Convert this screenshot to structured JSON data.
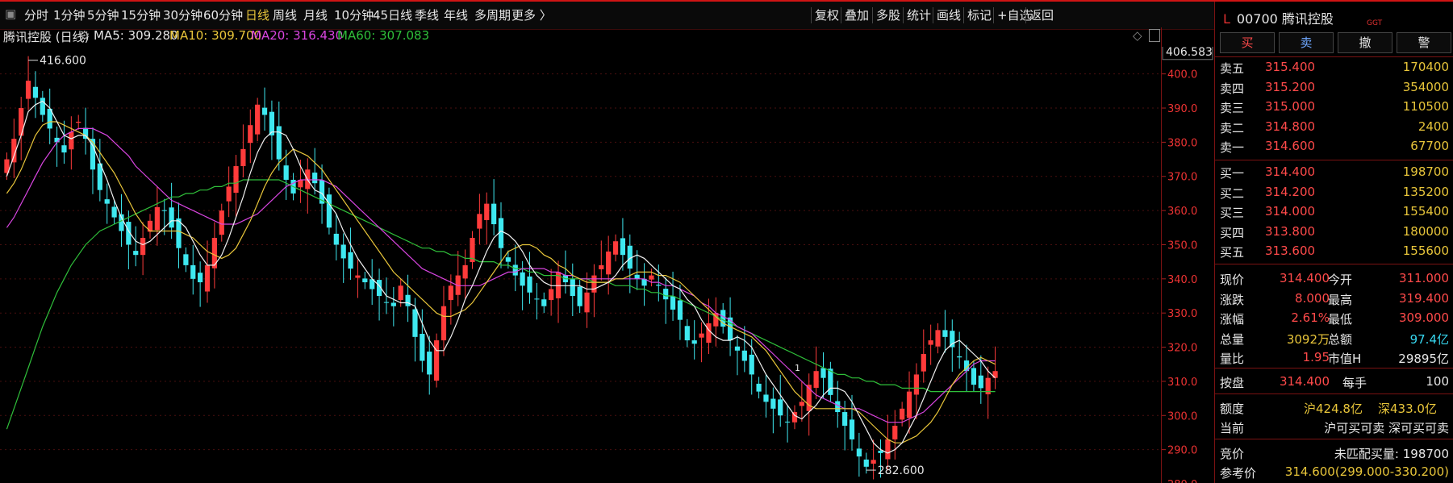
{
  "toolbar": {
    "periods": [
      "分时",
      "1分钟",
      "5分钟",
      "15分钟",
      "30分钟",
      "60分钟",
      "日线",
      "周线",
      "月线",
      "10分钟",
      "45日线",
      "季线",
      "年线",
      "多周期",
      "更多 〉"
    ],
    "active_period": "日线",
    "tools": [
      "复权",
      "叠加",
      "多股",
      "统计",
      "画线",
      "标记",
      "+自选",
      "返回"
    ]
  },
  "indicators": {
    "stock": "腾讯控股 (日线)",
    "ma5": "MA5: 309.280",
    "ma10": "MA10: 309.700",
    "ma20": "MA20: 316.430",
    "ma60": "MA60: 307.083"
  },
  "chart_data": {
    "type": "candlestick",
    "ylim": [
      280,
      407
    ],
    "y_ticks": [
      "400.0",
      "390.0",
      "380.0",
      "370.0",
      "360.0",
      "350.0",
      "340.0",
      "330.0",
      "320.0",
      "310.0",
      "300.0",
      "290.0",
      "280.0"
    ],
    "current_price_label": "406.583",
    "high_label": "416.600",
    "low_label": "282.600",
    "annotation": "1",
    "closes": [
      375,
      381,
      390,
      398,
      393,
      388,
      384,
      380,
      377,
      383,
      386,
      381,
      372,
      366,
      362,
      358,
      354,
      350,
      347,
      352,
      357,
      361,
      360,
      355,
      349,
      344,
      340,
      339,
      344,
      352,
      360,
      367,
      373,
      378,
      385,
      391,
      388,
      382,
      375,
      369,
      365,
      369,
      372,
      368,
      362,
      355,
      350,
      346,
      343,
      341,
      339,
      337,
      335,
      333,
      332,
      338,
      332,
      323,
      316,
      312,
      322,
      332,
      338,
      341,
      344,
      352,
      359,
      362,
      356,
      349,
      345,
      341,
      338,
      336,
      334,
      332,
      337,
      342,
      339,
      335,
      332,
      336,
      341,
      344,
      348,
      351,
      347,
      343,
      340,
      338,
      341,
      338,
      334,
      331,
      328,
      322,
      321,
      324,
      327,
      330,
      326,
      322,
      319,
      316,
      312,
      307,
      304,
      302,
      300,
      298,
      301,
      304,
      309,
      313,
      311,
      306,
      301,
      297,
      293,
      288,
      285,
      287,
      289,
      293,
      297,
      302,
      307,
      312,
      318,
      322,
      325,
      323,
      320,
      317,
      313,
      309,
      308,
      311,
      313
    ],
    "ma5": [
      370,
      376,
      382,
      389,
      391,
      392,
      390,
      386,
      382,
      381,
      382,
      382,
      379,
      374,
      369,
      363,
      358,
      354,
      351,
      350,
      351,
      353,
      355,
      357,
      357,
      355,
      351,
      347,
      344,
      344,
      347,
      352,
      358,
      364,
      371,
      377,
      381,
      383,
      383,
      382,
      378,
      373,
      369,
      366,
      365,
      362,
      359,
      354,
      350,
      346,
      343,
      340,
      338,
      335,
      334,
      333,
      333,
      332,
      327,
      322,
      319,
      319,
      323,
      328,
      334,
      338,
      343,
      348,
      352,
      354,
      353,
      351,
      348,
      344,
      341,
      339,
      338,
      338,
      338,
      338,
      338,
      337,
      337,
      338,
      339,
      341,
      344,
      346,
      347,
      346,
      344,
      342,
      340,
      338,
      337,
      334,
      332,
      328,
      325,
      323,
      322,
      322,
      323,
      322,
      320,
      316,
      312,
      309,
      306,
      303,
      300,
      299,
      301,
      303,
      306,
      308,
      308,
      307,
      304,
      300,
      296,
      292,
      290,
      289,
      290,
      292,
      296,
      300,
      305,
      310,
      315,
      319,
      321,
      322,
      320,
      318,
      316,
      313,
      311
    ],
    "ma10": [
      365,
      368,
      372,
      377,
      382,
      385,
      386,
      386,
      385,
      384,
      383,
      382,
      380,
      377,
      374,
      371,
      367,
      363,
      359,
      356,
      354,
      354,
      354,
      354,
      354,
      353,
      352,
      350,
      348,
      347,
      346,
      347,
      349,
      353,
      357,
      362,
      367,
      371,
      374,
      376,
      378,
      377,
      376,
      374,
      372,
      369,
      366,
      363,
      360,
      357,
      354,
      351,
      348,
      345,
      342,
      340,
      338,
      336,
      334,
      332,
      330,
      329,
      329,
      330,
      331,
      333,
      336,
      339,
      342,
      345,
      348,
      349,
      350,
      350,
      349,
      347,
      346,
      344,
      343,
      341,
      340,
      339,
      339,
      339,
      339,
      340,
      340,
      341,
      342,
      342,
      342,
      341,
      341,
      340,
      339,
      337,
      335,
      333,
      331,
      329,
      327,
      326,
      325,
      324,
      323,
      321,
      319,
      316,
      313,
      310,
      307,
      305,
      303,
      302,
      302,
      302,
      302,
      302,
      302,
      301,
      299,
      297,
      295,
      293,
      292,
      292,
      293,
      294,
      296,
      298,
      301,
      305,
      309,
      312,
      314,
      316,
      317,
      316,
      315
    ],
    "ma20": [
      355,
      358,
      362,
      366,
      370,
      374,
      377,
      380,
      382,
      383,
      384,
      384,
      384,
      383,
      382,
      380,
      378,
      376,
      373,
      371,
      369,
      367,
      365,
      363,
      362,
      361,
      360,
      359,
      358,
      357,
      356,
      356,
      356,
      357,
      358,
      359,
      361,
      363,
      365,
      367,
      368,
      369,
      369,
      369,
      369,
      368,
      367,
      365,
      363,
      361,
      359,
      357,
      355,
      353,
      351,
      349,
      347,
      345,
      343,
      342,
      341,
      340,
      339,
      338,
      338,
      338,
      338,
      339,
      340,
      341,
      342,
      342,
      343,
      343,
      343,
      343,
      342,
      342,
      341,
      341,
      340,
      340,
      340,
      340,
      340,
      340,
      340,
      340,
      340,
      340,
      339,
      339,
      338,
      338,
      337,
      336,
      335,
      333,
      332,
      330,
      329,
      328,
      326,
      325,
      324,
      322,
      320,
      318,
      316,
      314,
      312,
      310,
      308,
      306,
      305,
      304,
      303,
      302,
      302,
      302,
      301,
      300,
      299,
      298,
      298,
      298,
      299,
      300,
      301,
      303,
      305,
      307,
      309,
      311,
      313,
      315,
      316,
      316,
      316
    ],
    "ma60": [
      296,
      302,
      308,
      314,
      320,
      326,
      331,
      336,
      340,
      344,
      347,
      350,
      352,
      354,
      355,
      356,
      357,
      358,
      359,
      360,
      361,
      362,
      363,
      364,
      364,
      365,
      365,
      366,
      366,
      367,
      367,
      368,
      368,
      369,
      369,
      369,
      369,
      369,
      369,
      368,
      367,
      366,
      365,
      364,
      363,
      362,
      361,
      360,
      359,
      358,
      357,
      356,
      355,
      354,
      353,
      352,
      351,
      350,
      349,
      349,
      348,
      348,
      347,
      347,
      346,
      346,
      345,
      345,
      345,
      344,
      344,
      343,
      343,
      342,
      342,
      341,
      341,
      341,
      340,
      340,
      340,
      340,
      339,
      339,
      339,
      338,
      338,
      338,
      337,
      337,
      336,
      336,
      335,
      335,
      334,
      333,
      332,
      331,
      330,
      329,
      328,
      327,
      326,
      325,
      324,
      323,
      322,
      321,
      320,
      319,
      318,
      317,
      316,
      315,
      314,
      313,
      312,
      312,
      311,
      311,
      310,
      310,
      309,
      309,
      309,
      308,
      308,
      308,
      308,
      307,
      307,
      307,
      307,
      307,
      307,
      307,
      307,
      307,
      307
    ]
  },
  "side": {
    "header_marker": "L",
    "code_name": "00700 腾讯控股",
    "tag": "GGT",
    "buttons": [
      "买",
      "卖",
      "撤",
      "警"
    ],
    "asks": [
      {
        "label": "卖五",
        "price": "315.400",
        "vol": "170400"
      },
      {
        "label": "卖四",
        "price": "315.200",
        "vol": "354000"
      },
      {
        "label": "卖三",
        "price": "315.000",
        "vol": "110500"
      },
      {
        "label": "卖二",
        "price": "314.800",
        "vol": "2400"
      },
      {
        "label": "卖一",
        "price": "314.600",
        "vol": "67700"
      }
    ],
    "bids": [
      {
        "label": "买一",
        "price": "314.400",
        "vol": "198700"
      },
      {
        "label": "买二",
        "price": "314.200",
        "vol": "135200"
      },
      {
        "label": "买三",
        "price": "314.000",
        "vol": "155400"
      },
      {
        "label": "买四",
        "price": "313.800",
        "vol": "180000"
      },
      {
        "label": "买五",
        "price": "313.600",
        "vol": "155600"
      }
    ],
    "stats": [
      {
        "l1": "现价",
        "v1": "314.400",
        "l2": "今开",
        "v2": "311.000"
      },
      {
        "l1": "涨跌",
        "v1": "8.000",
        "l2": "最高",
        "v2": "319.400"
      },
      {
        "l1": "涨幅",
        "v1": "2.61%",
        "l2": "最低",
        "v2": "309.000"
      },
      {
        "l1": "总量",
        "v1": "3092万",
        "l2": "总额",
        "v2": "97.4亿"
      },
      {
        "l1": "量比",
        "v1": "1.95",
        "l2": "市值H",
        "v2": "29895亿"
      }
    ],
    "close_row": {
      "l1": "按盘",
      "v1": "314.400",
      "l2": "每手",
      "v2": "100"
    },
    "quota": {
      "label": "额度",
      "sh": "沪424.8亿",
      "sz": "深433.0亿"
    },
    "current": {
      "label": "当前",
      "value": "沪可买可卖 深可买可卖"
    },
    "auction": {
      "label": "竞价",
      "value": "未匹配买量: 198700"
    },
    "ref": {
      "label": "参考价",
      "value": "314.600(299.000-330.200)"
    }
  },
  "colors": {
    "up": "#ff3b3b",
    "down": "#3ee8f0",
    "ma5": "#f0f0f0",
    "ma10": "#e8c53a",
    "ma20": "#d845e0",
    "ma60": "#2fbf3a"
  }
}
